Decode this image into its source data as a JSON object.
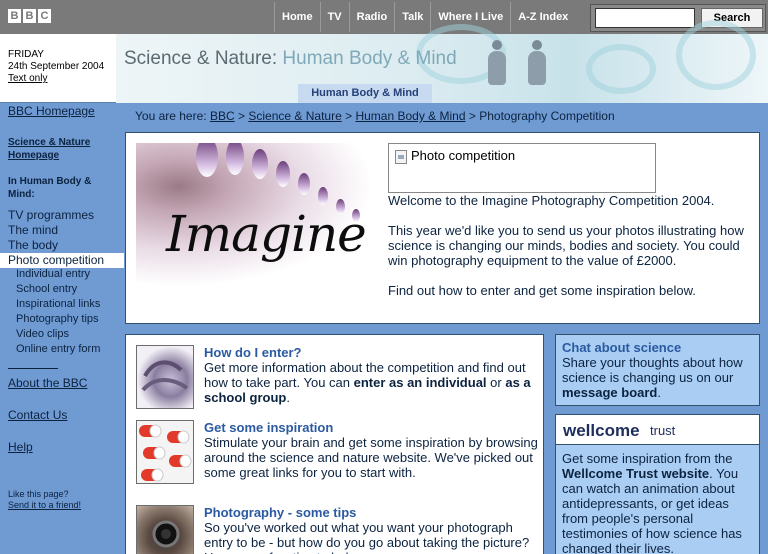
{
  "top_nav": {
    "logo_letters": [
      "B",
      "B",
      "C"
    ],
    "items": [
      "Home",
      "TV",
      "Radio",
      "Talk",
      "Where I Live",
      "A-Z Index"
    ],
    "search_placeholder": "",
    "search_label": "Search"
  },
  "header": {
    "day": "FRIDAY",
    "date": "24th September 2004",
    "text_only": "Text only",
    "banner_title": "Science & Nature:",
    "banner_subtitle": "Human Body & Mind",
    "section_tab": "Human Body & Mind"
  },
  "left_nav": {
    "bbc_homepage": "BBC Homepage",
    "sn_homepage_line1": "Science & Nature",
    "sn_homepage_line2": "Homepage",
    "section_head_line1": "In Human Body &",
    "section_head_line2": "Mind:",
    "items": [
      "TV programmes",
      "The mind",
      "The body",
      "Photo competition"
    ],
    "sub_items": [
      "Individual entry",
      "School entry",
      "Inspirational links",
      "Photography tips",
      "Video clips",
      "Online entry form"
    ],
    "about": "About the BBC",
    "contact": "Contact Us",
    "help": "Help",
    "like_page": "Like this page?",
    "send_friend": "Send it to a friend!"
  },
  "breadcrumb": {
    "prefix": "You are here:",
    "crumbs": [
      "BBC",
      "Science & Nature",
      "Human Body & Mind"
    ],
    "current": "Photography Competition",
    "sep": ">"
  },
  "intro": {
    "image_word": "Imagine",
    "photo_box_label": "Photo competition",
    "welcome": "Welcome to the Imagine Photography Competition 2004.",
    "body": "This year we'd like you to send us your photos illustrating how science is changing our minds, bodies and society. You could win photography equipment to the value of £2000.",
    "cta": "Find out how to enter and get some inspiration below."
  },
  "articles": [
    {
      "title": "How do I enter?",
      "body_start": "Get more information about the competition and find out how to take part. You can ",
      "bold1": "enter as an individual",
      "mid": " or ",
      "bold2": "as a school group",
      "end": "."
    },
    {
      "title": "Get some inspiration",
      "body": "Stimulate your brain and get some inspiration by browsing around the science and nature website. We've picked out some great links for you to start with."
    },
    {
      "title": "Photography - some tips",
      "body": "So you've worked out what you want your photograph entry to be - but how do you go about taking the picture? Here are a few tips to help"
    }
  ],
  "chat": {
    "title": "Chat about science",
    "body_start": "Share your thoughts about how science is changing us on our ",
    "bold": "message board",
    "end": "."
  },
  "wellcome": {
    "logo_bold": "wellcome",
    "logo_light": "trust",
    "body_start": "Get some inspiration from the ",
    "bold": "Wellcome Trust website",
    "body_end": ". You can watch an animation about antidepressants, or get ideas from people's personal testimonies of how science has changed their lives."
  },
  "colors": {
    "page_bg": "#6f9ad2",
    "topbar": "#7a7a7a",
    "link_blue": "#2a5aa0",
    "panel_light": "#a9cdf3"
  }
}
